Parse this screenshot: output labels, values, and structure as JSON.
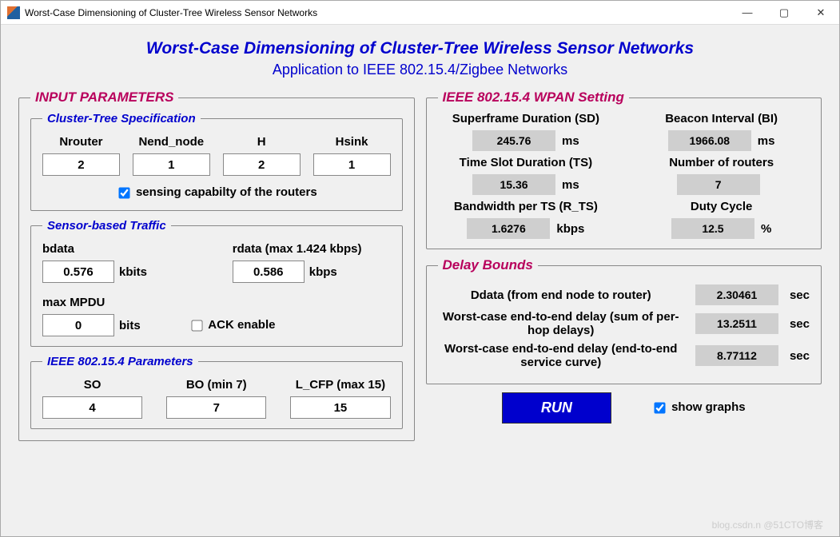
{
  "window": {
    "title": "Worst-Case Dimensioning of Cluster-Tree Wireless Sensor Networks"
  },
  "header": {
    "title": "Worst-Case Dimensioning of Cluster-Tree Wireless Sensor Networks",
    "subtitle": "Application to IEEE 802.15.4/Zigbee Networks"
  },
  "input": {
    "legend": "INPUT PARAMETERS",
    "cluster": {
      "legend": "Cluster-Tree Specification",
      "nrouter": {
        "label": "Nrouter",
        "value": "2"
      },
      "nend": {
        "label": "Nend_node",
        "value": "1"
      },
      "h": {
        "label": "H",
        "value": "2"
      },
      "hsink": {
        "label": "Hsink",
        "value": "1"
      },
      "sensing_label": "sensing capabilty of the routers",
      "sensing_checked": true
    },
    "traffic": {
      "legend": "Sensor-based Traffic",
      "bdata": {
        "label": "bdata",
        "value": "0.576",
        "unit": "kbits"
      },
      "rdata": {
        "label": "rdata (max 1.424 kbps)",
        "value": "0.586",
        "unit": "kbps"
      },
      "mpdu": {
        "label": "max MPDU",
        "value": "0",
        "unit": "bits"
      },
      "ack_label": "ACK enable",
      "ack_checked": false
    },
    "params": {
      "legend": "IEEE 802.15.4 Parameters",
      "so": {
        "label": "SO",
        "value": "4"
      },
      "bo": {
        "label": "BO (min 7)",
        "value": "7"
      },
      "lcfp": {
        "label": "L_CFP (max 15)",
        "value": "15"
      }
    }
  },
  "wpan": {
    "legend": "IEEE 802.15.4 WPAN Setting",
    "sd": {
      "label": "Superframe Duration (SD)",
      "value": "245.76",
      "unit": "ms"
    },
    "bi": {
      "label": "Beacon Interval (BI)",
      "value": "1966.08",
      "unit": "ms"
    },
    "ts": {
      "label": "Time Slot Duration (TS)",
      "value": "15.36",
      "unit": "ms"
    },
    "nr": {
      "label": "Number of routers",
      "value": "7",
      "unit": ""
    },
    "bw": {
      "label": "Bandwidth per TS (R_TS)",
      "value": "1.6276",
      "unit": "kbps"
    },
    "dc": {
      "label": "Duty Cycle",
      "value": "12.5",
      "unit": "%"
    }
  },
  "delay": {
    "legend": "Delay Bounds",
    "ddata": {
      "label": "Ddata (from end node to router)",
      "value": "2.30461",
      "unit": "sec"
    },
    "wc_sum": {
      "label": "Worst-case end-to-end delay (sum of per-hop delays)",
      "value": "13.2511",
      "unit": "sec"
    },
    "wc_e2e": {
      "label": "Worst-case end-to-end delay (end-to-end service curve)",
      "value": "8.77112",
      "unit": "sec"
    }
  },
  "actions": {
    "run": "RUN",
    "show_graphs": "show graphs",
    "show_graphs_checked": true
  }
}
